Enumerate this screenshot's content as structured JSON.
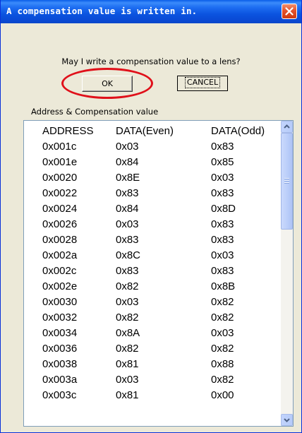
{
  "window": {
    "title": "A compensation value is written in."
  },
  "dialog": {
    "prompt": "May I write a compensation value to a lens?",
    "ok_label": "OK",
    "cancel_label": "CANCEL",
    "list_label": "Address & Compensation value"
  },
  "table": {
    "headers": [
      "ADDRESS",
      "DATA(Even)",
      "DATA(Odd)"
    ],
    "rows": [
      [
        "0x001c",
        "0x03",
        "0x83"
      ],
      [
        "0x001e",
        "0x84",
        "0x85"
      ],
      [
        "0x0020",
        "0x8E",
        "0x03"
      ],
      [
        "0x0022",
        "0x83",
        "0x83"
      ],
      [
        "0x0024",
        "0x84",
        "0x8D"
      ],
      [
        "0x0026",
        "0x03",
        "0x83"
      ],
      [
        "0x0028",
        "0x83",
        "0x83"
      ],
      [
        "0x002a",
        "0x8C",
        "0x03"
      ],
      [
        "0x002c",
        "0x83",
        "0x83"
      ],
      [
        "0x002e",
        "0x82",
        "0x8B"
      ],
      [
        "0x0030",
        "0x03",
        "0x82"
      ],
      [
        "0x0032",
        "0x82",
        "0x82"
      ],
      [
        "0x0034",
        "0x8A",
        "0x03"
      ],
      [
        "0x0036",
        "0x82",
        "0x82"
      ],
      [
        "0x0038",
        "0x81",
        "0x88"
      ],
      [
        "0x003a",
        "0x03",
        "0x82"
      ],
      [
        "0x003c",
        "0x81",
        "0x00"
      ]
    ]
  },
  "icons": {
    "close": "close-icon",
    "scroll_up": "arrow-up-icon",
    "scroll_down": "arrow-down-icon"
  },
  "colors": {
    "titlebar": "#0a4ad5",
    "dialog_bg": "#ece9d8",
    "annotation": "#e0101a",
    "close_button": "#e5522b"
  }
}
